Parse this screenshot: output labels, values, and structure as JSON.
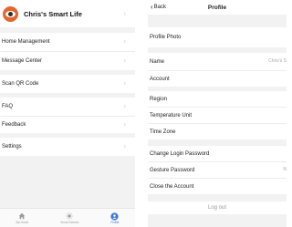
{
  "left": {
    "header": {
      "title": "Chris's Smart Life"
    },
    "items": [
      {
        "label": "Home Management"
      },
      {
        "label": "Message Center"
      },
      {
        "label": "Scan QR Code"
      },
      {
        "label": "FAQ"
      },
      {
        "label": "Feedback"
      },
      {
        "label": "Settings"
      }
    ],
    "chevron": "›",
    "tabs": [
      {
        "label": "My Home",
        "icon": "home-icon"
      },
      {
        "label": "Smart Scenes",
        "icon": "sun-icon"
      },
      {
        "label": "Profile",
        "icon": "profile-icon"
      }
    ]
  },
  "right": {
    "back_label": "Back",
    "title": "Profile",
    "items": {
      "profile_photo": "Profile Photo",
      "name": "Name",
      "name_value": "Chris's S",
      "account": "Account",
      "region": "Region",
      "temperature_unit": "Temperature Unit",
      "time_zone": "Time Zone",
      "change_login_password": "Change Login Password",
      "gesture_password": "Gesture Password",
      "gesture_password_value": "N",
      "close_account": "Close the Account"
    },
    "logout": "Log out"
  },
  "colors": {
    "accent": "#3d7bd8",
    "avatar": "#e1672f",
    "background": "#f2f2f2"
  }
}
